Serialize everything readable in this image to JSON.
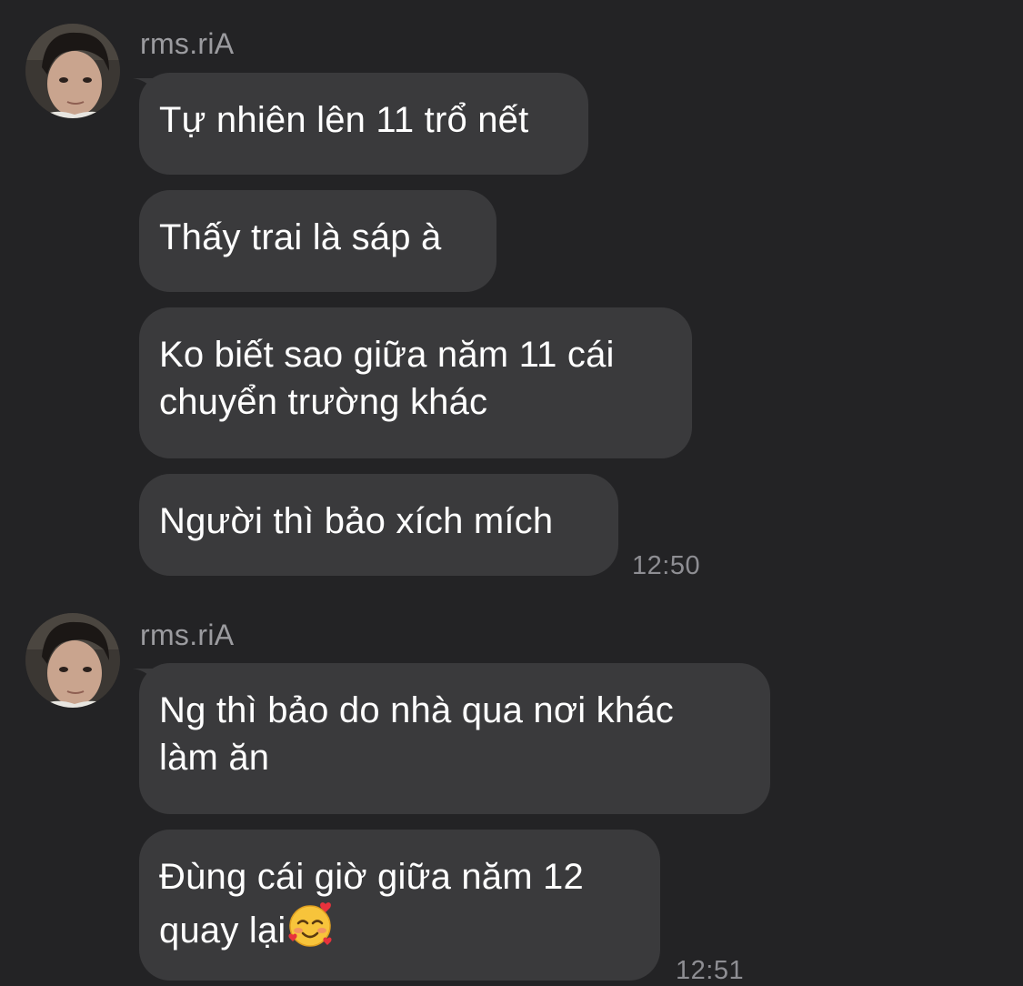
{
  "groups": [
    {
      "sender": "rms.riA",
      "messages": [
        {
          "lines": [
            "Tự nhiên lên 11 trổ nết"
          ]
        },
        {
          "lines": [
            "Thấy trai là sáp à"
          ]
        },
        {
          "lines": [
            "Ko biết sao giữa năm 11 cái",
            "chuyển trường khác"
          ]
        },
        {
          "lines": [
            "Người thì bảo xích mích"
          ]
        }
      ],
      "time": "12:50"
    },
    {
      "sender": "rms.riA",
      "messages": [
        {
          "lines": [
            "Ng thì bảo do nhà qua nơi khác",
            "làm ăn"
          ]
        },
        {
          "lines": [
            "Đùng cái giờ giữa năm 12",
            "quay lại"
          ],
          "trailing_emoji": "smiling-face-with-hearts"
        }
      ],
      "time": "12:51"
    }
  ],
  "colors": {
    "background": "#232325",
    "bubble": "#3a3a3c",
    "text": "#ffffff",
    "meta_text": "#8e8e93"
  }
}
